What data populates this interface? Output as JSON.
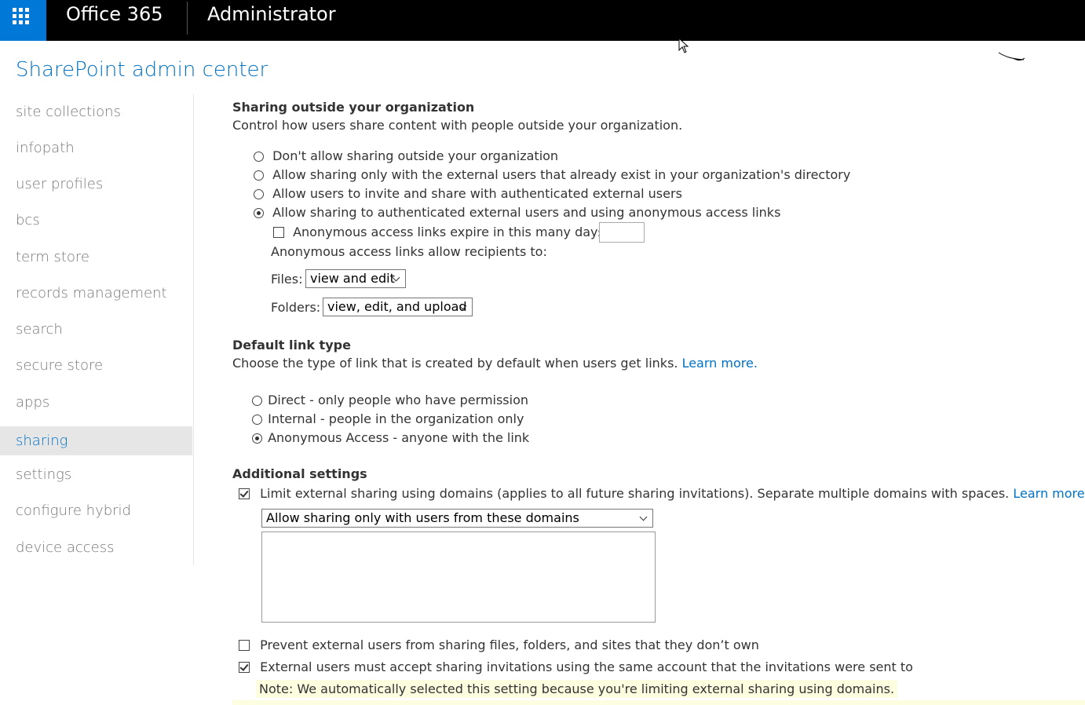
{
  "topbar": {
    "brand": "Office 365",
    "app_title": "Administrator",
    "waffle_icon": "app-launcher-icon",
    "accent": "#0078d7"
  },
  "page_title": "SharePoint admin center",
  "nav": {
    "items": [
      {
        "label": "site collections"
      },
      {
        "label": "infopath"
      },
      {
        "label": "user profiles"
      },
      {
        "label": "bcs"
      },
      {
        "label": "term store"
      },
      {
        "label": "records management"
      },
      {
        "label": "search"
      },
      {
        "label": "secure store"
      },
      {
        "label": "apps"
      },
      {
        "label": "sharing"
      },
      {
        "label": "settings"
      },
      {
        "label": "configure hybrid"
      },
      {
        "label": "device access"
      }
    ],
    "selected": "sharing"
  },
  "sharing_outside": {
    "heading": "Sharing outside your organization",
    "description": "Control how users share content with people outside your organization.",
    "options": [
      "Don't allow sharing outside your organization",
      "Allow sharing only with the external users that already exist in your organization's directory",
      "Allow users to invite and share with authenticated external users",
      "Allow sharing to authenticated external users and using anonymous access links"
    ],
    "selected": "Allow sharing to authenticated external users and using anonymous access links",
    "expire_label": "Anonymous access links expire in this many days:",
    "expire_checked": false,
    "expire_value": "",
    "recipients_label": "Anonymous access links allow recipients to:",
    "files_label": "Files:",
    "files_value": "view and edit",
    "folders_label": "Folders:",
    "folders_value": "view, edit, and upload"
  },
  "default_link": {
    "heading": "Default link type",
    "description": "Choose the type of link that is created by default when users get links.",
    "learn_more": "Learn more.",
    "options": [
      "Direct - only people who have permission",
      "Internal - people in the organization only",
      "Anonymous Access - anyone with the link"
    ],
    "selected": "Anonymous Access - anyone with the link"
  },
  "additional": {
    "heading": "Additional settings",
    "limit_domains_label": "Limit external sharing using domains (applies to all future sharing invitations). Separate multiple domains with spaces.",
    "limit_domains_learn_more": "Learn more.",
    "limit_domains_checked": true,
    "domain_mode_value": "Allow sharing only with users from these domains",
    "domains_text": "",
    "prevent_resharing_label": "Prevent external users from sharing files, folders, and sites that they don’t own",
    "prevent_resharing_checked": false,
    "same_account_label": "External users must accept sharing invitations using the same account that the invitations were sent to",
    "same_account_checked": true,
    "note": "Note: We automatically selected this setting because you're limiting external sharing using domains.",
    "note_color": "#fdfde0"
  }
}
